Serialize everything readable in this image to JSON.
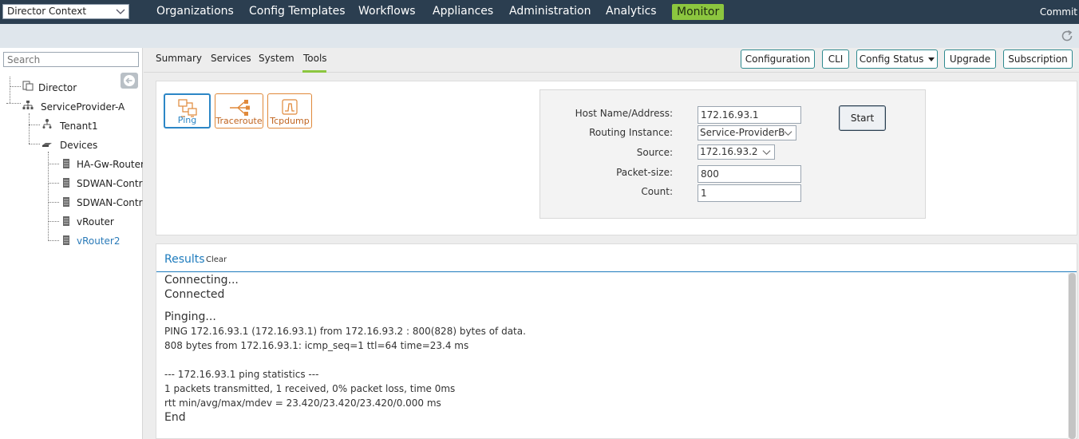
{
  "nav": {
    "context": "Director Context",
    "items": [
      "Organizations",
      "Config Templates",
      "Workflows",
      "Appliances",
      "Administration",
      "Analytics"
    ],
    "active": "Monitor",
    "commit": "Commit"
  },
  "sidebar": {
    "search_placeholder": "Search",
    "tree": {
      "director": "Director",
      "sp": "ServiceProvider-A",
      "tenant": "Tenant1",
      "devices": "Devices",
      "device_items": [
        "HA-Gw-Router",
        "SDWAN-Controller",
        "SDWAN-Controller",
        "vRouter",
        "vRouter2"
      ]
    }
  },
  "tabs": [
    "Summary",
    "Services",
    "System",
    "Tools"
  ],
  "active_tab": "Tools",
  "actions": [
    "Configuration",
    "CLI",
    "Config Status",
    "Upgrade",
    "Subscription"
  ],
  "tools": [
    "Ping",
    "Traceroute",
    "Tcpdump"
  ],
  "form": {
    "host_label": "Host Name/Address:",
    "host_value": "172.16.93.1",
    "routing_label": "Routing Instance:",
    "routing_value": "Service-ProviderB",
    "source_label": "Source:",
    "source_value": "172.16.93.2",
    "packet_label": "Packet-size:",
    "packet_value": "800",
    "count_label": "Count:",
    "count_value": "1",
    "start": "Start"
  },
  "results": {
    "title": "Results",
    "clear": "Clear",
    "lines": [
      "Connecting...",
      "Connected",
      "Pinging...",
      "PING 172.16.93.1 (172.16.93.1) from 172.16.93.2 : 800(828) bytes of data.",
      "808 bytes from 172.16.93.1: icmp_seq=1 ttl=64 time=23.4 ms",
      "--- 172.16.93.1 ping statistics ---",
      "1 packets transmitted, 1 received, 0% packet loss, time 0ms",
      "rtt min/avg/max/mdev = 23.420/23.420/23.420/0.000 ms",
      "End"
    ]
  },
  "colors": {
    "nav_bg": "#2b3e50",
    "accent_green": "#8cc63f",
    "link_blue": "#1d7bbd",
    "tool_orange": "#e0893a"
  }
}
